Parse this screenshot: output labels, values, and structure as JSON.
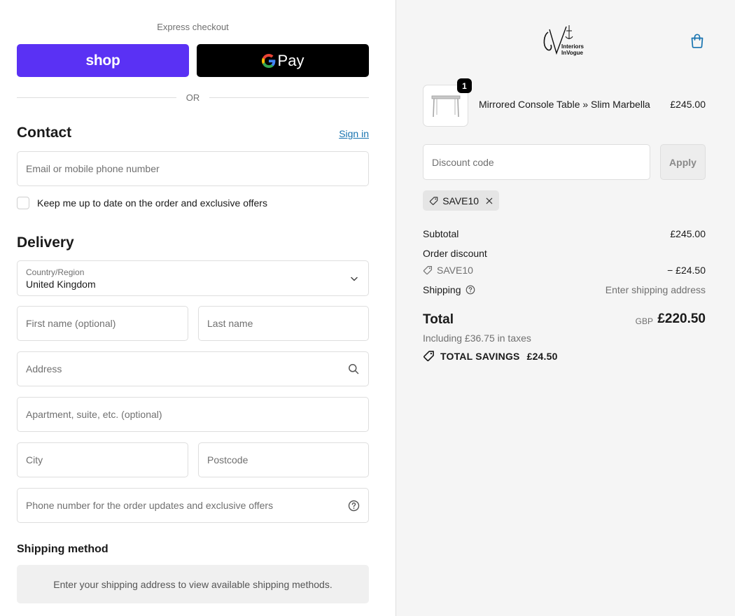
{
  "express": {
    "title": "Express checkout",
    "shop_label": "shop",
    "gpay_label": "Pay",
    "or_label": "OR"
  },
  "contact": {
    "heading": "Contact",
    "signin_label": "Sign in",
    "email_placeholder": "Email or mobile phone number",
    "newsletter_label": "Keep me up to date on the order and exclusive offers",
    "newsletter_checked": false
  },
  "delivery": {
    "heading": "Delivery",
    "country_label": "Country/Region",
    "country_value": "United Kingdom",
    "first_name_placeholder": "First name (optional)",
    "last_name_placeholder": "Last name",
    "address_placeholder": "Address",
    "apartment_placeholder": "Apartment, suite, etc. (optional)",
    "city_placeholder": "City",
    "postcode_placeholder": "Postcode",
    "phone_placeholder": "Phone number for the order updates and exclusive offers"
  },
  "shipping_method": {
    "heading": "Shipping method",
    "message": "Enter your shipping address to view available shipping methods."
  },
  "brand": {
    "logo_line1": "Interiors",
    "logo_line2": "InVogue"
  },
  "cart": {
    "item": {
      "quantity": "1",
      "name": "Mirrored Console Table » Slim Marbella",
      "price": "£245.00"
    },
    "discount_placeholder": "Discount code",
    "apply_label": "Apply",
    "applied_code": "SAVE10"
  },
  "summary": {
    "subtotal_label": "Subtotal",
    "subtotal_value": "£245.00",
    "order_discount_label": "Order discount",
    "discount_code": "SAVE10",
    "discount_value": "− £24.50",
    "shipping_label": "Shipping",
    "shipping_value": "Enter shipping address",
    "total_label": "Total",
    "currency": "GBP",
    "total_value": "£220.50",
    "taxes_note": "Including £36.75 in taxes",
    "savings_label": "TOTAL SAVINGS",
    "savings_value": "£24.50"
  },
  "colors": {
    "shop_purple": "#5a31f4",
    "link_blue": "#1773b0",
    "cart_icon": "#1773b0"
  }
}
